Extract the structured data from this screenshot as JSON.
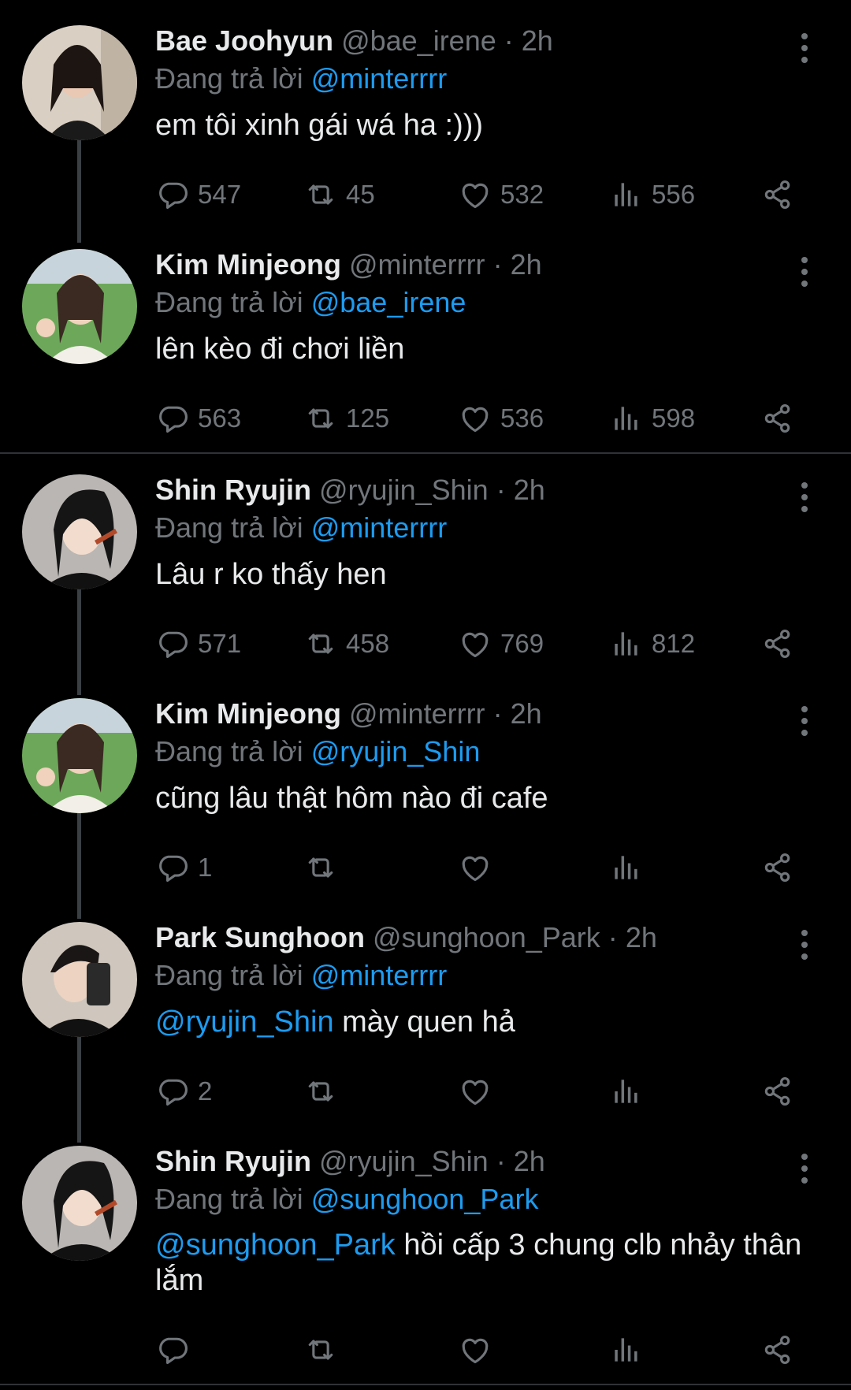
{
  "tweets": [
    {
      "name": "Bae Joohyun",
      "handle": "@bae_irene",
      "sep": "·",
      "time": "2h",
      "replying_prefix": "Đang trả lời",
      "replying_to": "@minterrrr",
      "text_mention": "",
      "text": "em tôi xinh gái wá ha :)))",
      "replies": "547",
      "retweets": "45",
      "likes": "532",
      "views": "556"
    },
    {
      "name": "Kim Minjeong",
      "handle": "@minterrrr",
      "sep": "·",
      "time": "2h",
      "replying_prefix": "Đang trả lời",
      "replying_to": "@bae_irene",
      "text_mention": "",
      "text": "lên kèo đi chơi liền",
      "replies": "563",
      "retweets": "125",
      "likes": "536",
      "views": "598"
    },
    {
      "name": "Shin Ryujin",
      "handle": "@ryujin_Shin",
      "sep": "·",
      "time": "2h",
      "replying_prefix": "Đang trả lời",
      "replying_to": "@minterrrr",
      "text_mention": "",
      "text": "Lâu r ko thấy hen",
      "replies": "571",
      "retweets": "458",
      "likes": "769",
      "views": "812"
    },
    {
      "name": "Kim Minjeong",
      "handle": "@minterrrr",
      "sep": "·",
      "time": "2h",
      "replying_prefix": "Đang trả lời",
      "replying_to": "@ryujin_Shin",
      "text_mention": "",
      "text": "cũng lâu thật hôm nào đi cafe",
      "replies": "1",
      "retweets": "",
      "likes": "",
      "views": ""
    },
    {
      "name": "Park Sunghoon",
      "handle": "@sunghoon_Park",
      "sep": "·",
      "time": "2h",
      "replying_prefix": "Đang trả lời",
      "replying_to": "@minterrrr",
      "text_mention": "@ryujin_Shin",
      "text": " mày quen hả",
      "replies": "2",
      "retweets": "",
      "likes": "",
      "views": ""
    },
    {
      "name": "Shin Ryujin",
      "handle": "@ryujin_Shin",
      "sep": "·",
      "time": "2h",
      "replying_prefix": "Đang trả lời",
      "replying_to": "@sunghoon_Park",
      "text_mention": "@sunghoon_Park",
      "text": " hồi cấp 3 chung clb nhảy thân lắm",
      "replies": "",
      "retweets": "",
      "likes": "",
      "views": ""
    }
  ],
  "colors": {
    "background": "#000000",
    "text": "#e7e9ea",
    "muted": "#71767b",
    "link": "#1d9bf0"
  },
  "icons": [
    "reply-icon",
    "retweet-icon",
    "like-icon",
    "views-icon",
    "share-icon",
    "more-icon"
  ]
}
